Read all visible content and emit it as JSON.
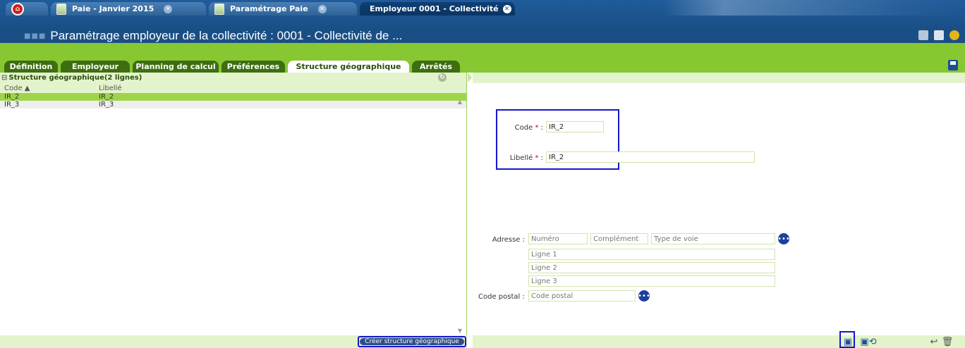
{
  "tabs": [
    {
      "label": "Paie - Janvier 2015"
    },
    {
      "label": "Paramétrage Paie"
    },
    {
      "label": "Employeur 0001 - Collectivité"
    }
  ],
  "page_title": "Paramétrage employeur de la collectivité : 0001 - Collectivité de ...",
  "sub_tabs": [
    {
      "label": "Définition"
    },
    {
      "label": "Employeur"
    },
    {
      "label": "Planning de calcul"
    },
    {
      "label": "Préférences"
    },
    {
      "label": "Structure géographique"
    },
    {
      "label": "Arrêtés"
    }
  ],
  "list": {
    "title": "Structure géographique(2 lignes)",
    "col_code": "Code",
    "col_libelle": "Libellé",
    "rows": [
      {
        "code": "IR_2",
        "libelle": "IR_2"
      },
      {
        "code": "IR_3",
        "libelle": "IR_3"
      }
    ],
    "create_button": "Créer structure géographique"
  },
  "form": {
    "code_label": "Code",
    "code_value": "IR_2",
    "libelle_label": "Libellé",
    "libelle_value": "IR_2",
    "adresse_label": "Adresse :",
    "numero_ph": "Numéro",
    "complement_ph": "Complément",
    "type_voie_ph": "Type de voie",
    "ligne1_ph": "Ligne 1",
    "ligne2_ph": "Ligne 2",
    "ligne3_ph": "Ligne 3",
    "code_postal_label": "Code postal :",
    "code_postal_ph": "Code postal"
  },
  "colors": {
    "accent_green": "#87c732",
    "header_blue": "#1a4f86",
    "highlight_frame": "#1616cf"
  }
}
